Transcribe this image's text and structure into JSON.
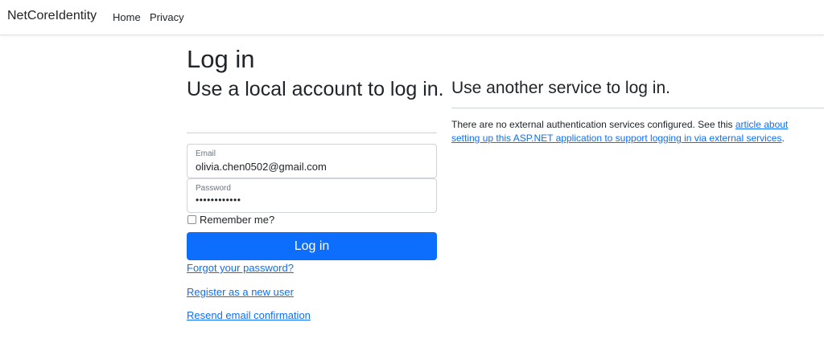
{
  "navbar": {
    "brand": "NetCoreIdentity",
    "links": [
      "Home",
      "Privacy"
    ]
  },
  "login": {
    "title": "Log in",
    "subtitle": "Use a local account to log in.",
    "email": {
      "label": "Email",
      "value": "olivia.chen0502@gmail.com"
    },
    "password": {
      "label": "Password",
      "masked_value": "••••••••••••"
    },
    "remember_label": "Remember me?",
    "remember_checked": false,
    "submit_label": "Log in",
    "forgot_link": "Forgot your password?",
    "register_link": "Register as a new user",
    "resend_link": "Resend email confirmation"
  },
  "external": {
    "title": "Use another service to log in.",
    "text_before": "There are no external authentication services configured. See this ",
    "link_text": "article about setting up this ASP.NET application to support logging in via external services",
    "text_after": "."
  },
  "colors": {
    "primary": "#0d6efd",
    "text": "#212529",
    "muted": "#6c757d",
    "border": "#ced4da"
  }
}
